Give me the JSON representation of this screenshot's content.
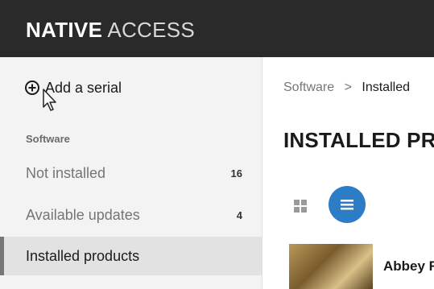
{
  "header": {
    "app_name_bold": "NATIVE",
    "app_name_light": "ACCESS"
  },
  "sidebar": {
    "add_serial_label": "Add a serial",
    "section_label": "Software",
    "items": [
      {
        "label": "Not installed",
        "count": "16"
      },
      {
        "label": "Available updates",
        "count": "4"
      },
      {
        "label": "Installed products",
        "count": ""
      }
    ]
  },
  "main": {
    "breadcrumb": {
      "root": "Software",
      "separator": ">",
      "current": "Installed"
    },
    "title": "INSTALLED PR",
    "products": [
      {
        "name": "Abbey R"
      }
    ]
  },
  "colors": {
    "topbar": "#2a2a2a",
    "accent": "#2d7dc6",
    "active_item_bg": "#e2e2e2"
  }
}
